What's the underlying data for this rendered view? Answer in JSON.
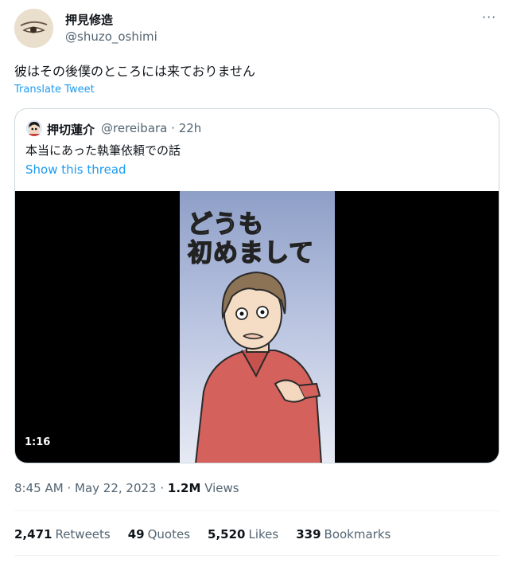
{
  "author": {
    "name": "押見修造",
    "handle": "@shuzo_oshimi"
  },
  "more_label": "···",
  "tweet": {
    "text": "彼はその後僕のところには来ておりません",
    "translate_label": "Translate Tweet"
  },
  "quoted": {
    "name": "押切蓮介",
    "handle": "@rereibara",
    "separator": "·",
    "time": "22h",
    "text": "本当にあった執筆依頼での話",
    "show_thread_label": "Show this thread",
    "video": {
      "caption_line1": "どうも",
      "caption_line2": "初めまして",
      "duration": "1:16"
    }
  },
  "meta": {
    "time": "8:45 AM",
    "dot1": "·",
    "date": "May 22, 2023",
    "dot2": "·",
    "views_count": "1.2M",
    "views_label": "Views"
  },
  "stats": {
    "retweets_count": "2,471",
    "retweets_label": "Retweets",
    "quotes_count": "49",
    "quotes_label": "Quotes",
    "likes_count": "5,520",
    "likes_label": "Likes",
    "bookmarks_count": "339",
    "bookmarks_label": "Bookmarks"
  }
}
